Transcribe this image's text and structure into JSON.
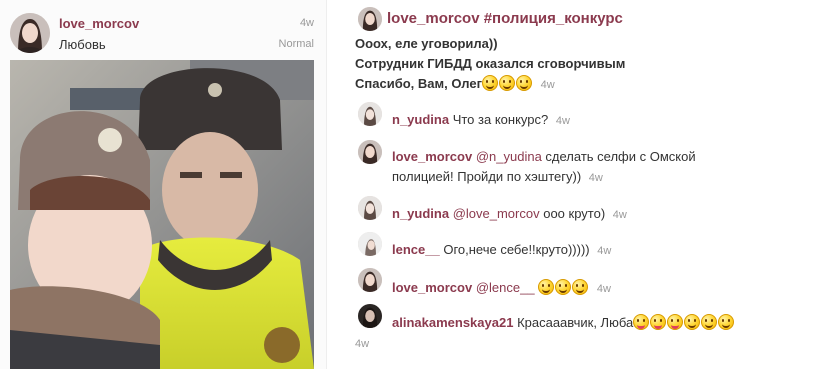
{
  "post": {
    "username": "love_morcov",
    "caption": "Любовь",
    "time": "4w",
    "filter": "Normal"
  },
  "icons": {
    "avatar": "user-avatar-icon",
    "emoji_smile": "smiling-face-emoji",
    "emoji_tongue": "winking-face-with-tongue-emoji"
  },
  "colors": {
    "username": "#8b3a4e",
    "text": "#333333",
    "muted": "#999999"
  },
  "main_comment": {
    "username": "love_morcov",
    "hashtag": "#полиция_конкурс",
    "line1": "Ооох, еле уговорила))",
    "line2": "Сотрудник ГИБДД оказался сговорчивым",
    "line3": "Спасибо, Вам, Олег",
    "time": "4w"
  },
  "comments": [
    {
      "username": "n_yudina",
      "text": "Что за конкурс?",
      "time": "4w"
    },
    {
      "username": "love_morcov",
      "mention": "@n_yudina",
      "text": " сделать селфи с Омской",
      "text2": "полицией! Пройди по хэштегу))",
      "time": "4w"
    },
    {
      "username": "n_yudina",
      "mention": "@love_morcov",
      "text": " ооо круто)",
      "time": "4w"
    },
    {
      "username": "lence__",
      "text": "Ого,нече себе!!круто)))))",
      "time": "4w"
    },
    {
      "username": "love_morcov",
      "mention": "@lence__",
      "text": " ",
      "time": "4w"
    },
    {
      "username": "alinakamenskaya21",
      "text": "Красааавчик, Люба",
      "time": "4w"
    }
  ]
}
